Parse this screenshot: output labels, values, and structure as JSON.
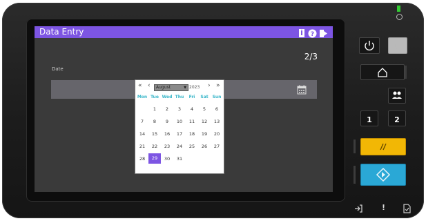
{
  "screen": {
    "title": "Data Entry",
    "page_indicator": "2/3",
    "field_label": "Date",
    "titlebar_color": "#7d55e3",
    "titlebar_icons": [
      "info-icon",
      "help-icon",
      "logout-icon"
    ]
  },
  "datepicker": {
    "nav_prev_year": "«",
    "nav_prev_month": "‹",
    "nav_next_month": "›",
    "nav_next_year": "»",
    "month": "August",
    "year": "2023",
    "weekdays": [
      "Mon",
      "Tue",
      "Wed",
      "Thu",
      "Fri",
      "Sat",
      "Sun"
    ],
    "weeks": [
      [
        "",
        "1",
        "2",
        "3",
        "4",
        "5",
        "6"
      ],
      [
        "7",
        "8",
        "9",
        "10",
        "11",
        "12",
        "13"
      ],
      [
        "14",
        "15",
        "16",
        "17",
        "18",
        "19",
        "20"
      ],
      [
        "21",
        "22",
        "23",
        "24",
        "25",
        "26",
        "27"
      ],
      [
        "28",
        "29",
        "30",
        "31",
        "",
        "",
        ""
      ]
    ],
    "selected_day": "29",
    "selected_color": "#7d55e3"
  },
  "hardware": {
    "power_icon": "power-icon",
    "sleep_icon": "moon-icon",
    "home_icon": "home-icon",
    "users_icon": "users-icon",
    "preset_1": "1",
    "preset_2": "2",
    "clear_icon": "clear-icon",
    "start_icon": "start-icon",
    "clear_color": "#f2b705",
    "start_color": "#2aa8d6",
    "status_icons": [
      "login-icon",
      "alert-icon",
      "document-icon"
    ],
    "exclamation": "!",
    "led_color": "#33cc33"
  }
}
